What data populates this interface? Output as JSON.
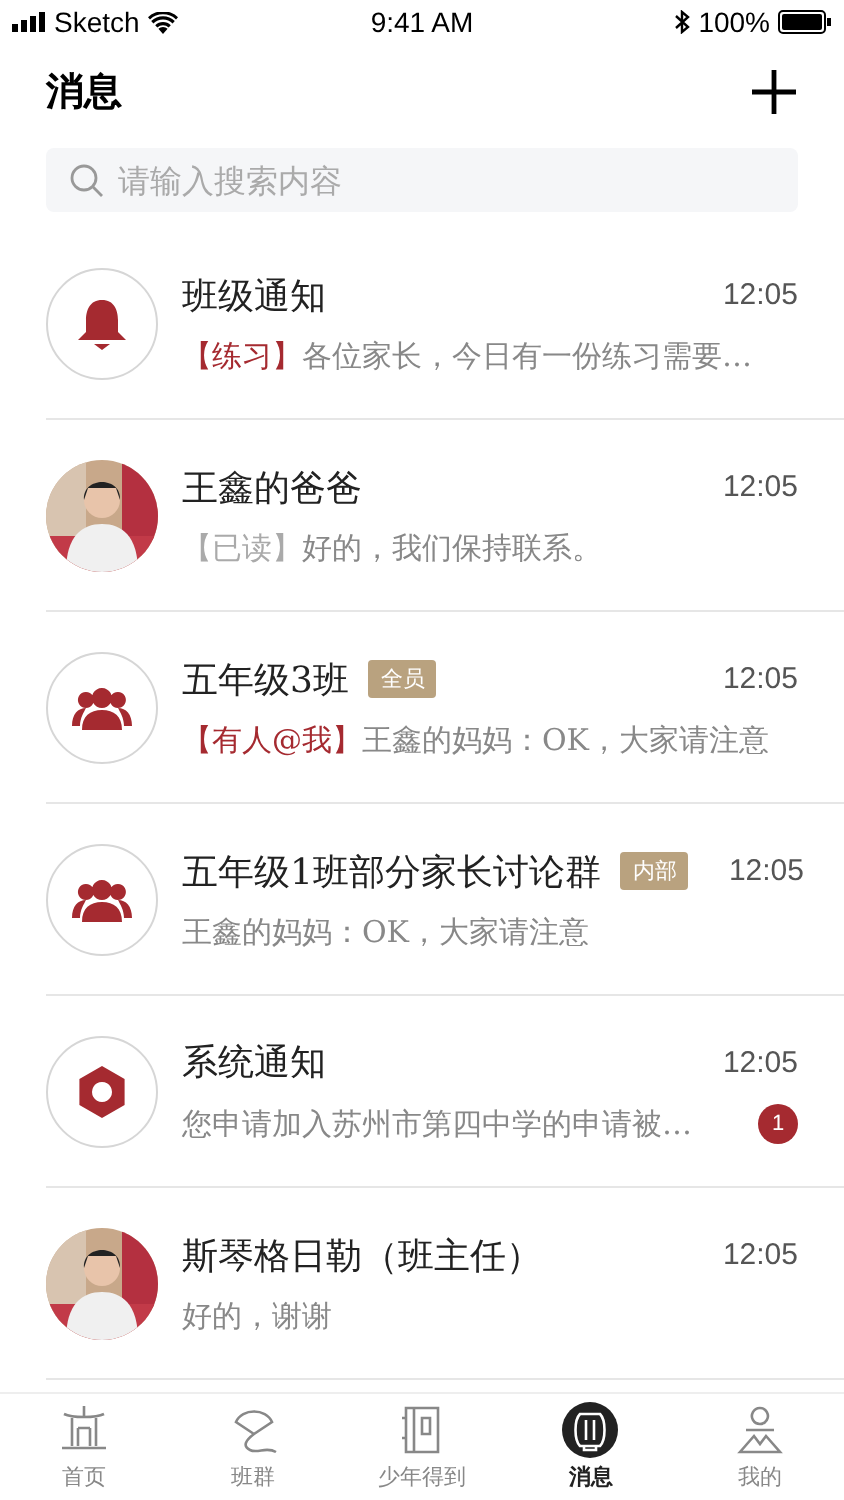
{
  "status_bar": {
    "carrier": "Sketch",
    "time": "9:41 AM",
    "battery": "100%"
  },
  "header": {
    "title": "消息"
  },
  "search": {
    "placeholder": "请输入搜索内容"
  },
  "conversations": [
    {
      "kind": "bell",
      "name": "班级通知",
      "time": "12:05",
      "tag": {
        "text": "【练习】",
        "color": "#a52a30"
      },
      "preview": "各位家长，今日有一份练习需要…"
    },
    {
      "kind": "picture",
      "name": "王鑫的爸爸",
      "time": "12:05",
      "tag": {
        "text": "【已读】",
        "color": "#aaaaaa"
      },
      "preview": "好的，我们保持联系。"
    },
    {
      "kind": "group",
      "name": "五年级3班",
      "badge": "全员",
      "time": "12:05",
      "tag": {
        "text": "【有人@我】",
        "color": "#a52a30"
      },
      "preview": "王鑫的妈妈：OK，大家请注意"
    },
    {
      "kind": "group",
      "name": "五年级1班部分家长讨论群",
      "badge": "内部",
      "time": "12:05",
      "preview": "王鑫的妈妈：OK，大家请注意"
    },
    {
      "kind": "system",
      "name": "系统通知",
      "time": "12:05",
      "preview": "您申请加入苏州市第四中学的申请被…",
      "unread": "1"
    },
    {
      "kind": "picture",
      "name": "斯琴格日勒（班主任）",
      "time": "12:05",
      "preview": "好的，谢谢"
    }
  ],
  "tab_bar": [
    {
      "label": "首页",
      "selected": false
    },
    {
      "label": "班群",
      "selected": false
    },
    {
      "label": "少年得到",
      "selected": false
    },
    {
      "label": "消息",
      "selected": true
    },
    {
      "label": "我的",
      "selected": false
    }
  ]
}
